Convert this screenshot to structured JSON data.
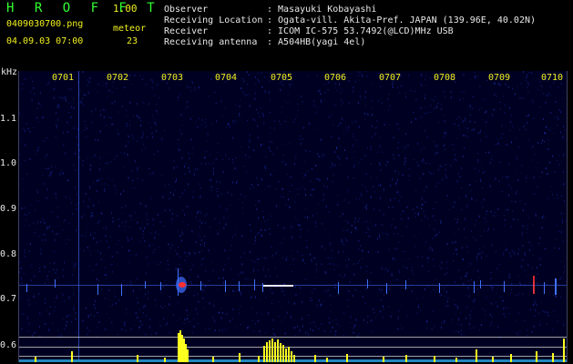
{
  "header": {
    "brand": "H R O F F T",
    "version": "1.00",
    "filename": "0409030700.png",
    "datetime": "04.09.03 07:00",
    "detection_label": "meteor",
    "detection_count": "23"
  },
  "station": [
    {
      "label": "Observer",
      "value": ": Masayuki Kobayashi"
    },
    {
      "label": "Receiving Location",
      "value": ": Ogata-vill. Akita-Pref. JAPAN (139.96E, 40.02N)"
    },
    {
      "label": "Receiver",
      "value": ": ICOM IC-575 53.7492(@LCD)MHz USB"
    },
    {
      "label": "Receiving antenna",
      "value": ": A504HB(yagi 4el)"
    }
  ],
  "spectrogram": {
    "y_unit_label": "kHz",
    "y_ticks": [
      "1.1",
      "1.0",
      "0.9",
      "0.8",
      "0.7",
      "0.6"
    ],
    "x_ticks": [
      "0701",
      "0702",
      "0703",
      "0704",
      "0705",
      "0706",
      "0707",
      "0708",
      "0709",
      "0710"
    ],
    "colors": {
      "background": "#000022",
      "noise": "#1a2aa0",
      "carrier": "#4070ff",
      "echo_hot": "#ff3030",
      "histogram": "#ffff20",
      "baseline": "#30c0ff"
    }
  },
  "chart_data": {
    "type": "heatmap",
    "x": [
      "0701",
      "0702",
      "0703",
      "0704",
      "0705",
      "0706",
      "0707",
      "0708",
      "0709",
      "0710"
    ],
    "ylabel": "kHz",
    "ylim": [
      0.58,
      1.19
    ],
    "carrier_khz": 0.735,
    "echoes": [
      {
        "minute": 7.04,
        "type": "strong",
        "count_peak": 8
      },
      {
        "minute": 7.05,
        "type": "long",
        "count_peak": 5
      }
    ],
    "detection_count": 23
  }
}
